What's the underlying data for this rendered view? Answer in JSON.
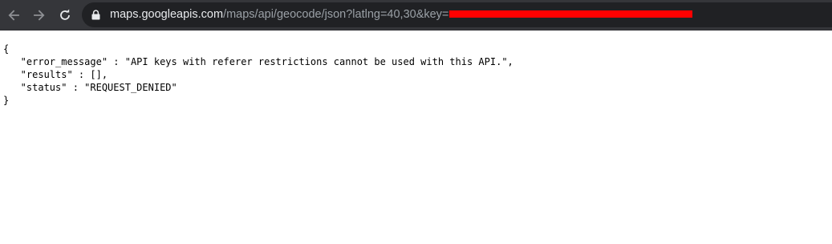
{
  "browser": {
    "url_host": "maps.googleapis.com",
    "url_path": "/maps/api/geocode/json?latlng=40,30&key=",
    "icons": {
      "back": "arrow-left-icon",
      "forward": "arrow-right-icon",
      "reload": "reload-icon",
      "security": "lock-icon"
    }
  },
  "response": {
    "open_brace": "{",
    "line1": "   \"error_message\" : \"API keys with referer restrictions cannot be used with this API.\",",
    "line2": "   \"results\" : [],",
    "line3": "   \"status\" : \"REQUEST_DENIED\"",
    "close_brace": "}"
  },
  "colors": {
    "toolbar": "#35363a",
    "omnibox": "#202124",
    "redaction": "#ff0000"
  }
}
